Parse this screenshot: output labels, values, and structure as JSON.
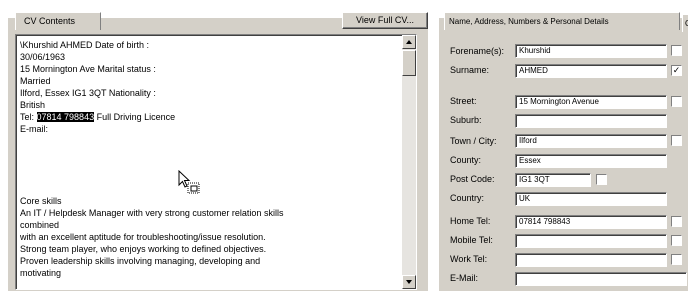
{
  "left_panel": {
    "tab_label": "CV Contents",
    "view_button_label": "View Full CV...",
    "lines": [
      "\\Khurshid AHMED Date of birth :",
      "30/06/1963",
      "15 Mornington Ave Marital status :",
      "Married",
      "Ilford, Essex IG1 3QT Nationality :",
      "British"
    ],
    "tel": {
      "prefix": "Tel: ",
      "highlighted": "07814 798843",
      "suffix": " Full Driving Licence"
    },
    "email_line": "E-mail:",
    "lines2": [
      "Core skills",
      "An IT / Helpdesk Manager with very strong customer relation skills",
      "combined",
      "with an excellent aptitude for troubleshooting/issue resolution.",
      "Strong team player, who enjoys working to defined objectives.",
      "Proven leadership skills involving managing, developing and",
      "motivating"
    ]
  },
  "right_panel": {
    "tab_label": "Name, Address, Numbers & Personal Details",
    "tab2_label": "C",
    "fields": {
      "forename": {
        "label": "Forename(s):",
        "value": "Khurshid",
        "checked": false
      },
      "surname": {
        "label": "Surname:",
        "value": "AHMED",
        "checked": true
      },
      "street": {
        "label": "Street:",
        "value": "15 Mornington Avenue",
        "checked": false
      },
      "suburb": {
        "label": "Suburb:",
        "value": ""
      },
      "town": {
        "label": "Town / City:",
        "value": "Ilford",
        "checked": false
      },
      "county": {
        "label": "County:",
        "value": "Essex"
      },
      "postcode": {
        "label": "Post Code:",
        "value": "IG1 3QT",
        "checked": false
      },
      "country": {
        "label": "Country:",
        "value": "UK"
      },
      "home_tel": {
        "label": "Home Tel:",
        "value": "07814 798843",
        "checked": false
      },
      "mobile_tel": {
        "label": "Mobile Tel:",
        "value": "",
        "checked": false
      },
      "work_tel": {
        "label": "Work Tel:",
        "value": "",
        "checked": false
      },
      "email": {
        "label": "E-Mail:",
        "value": ""
      }
    }
  }
}
